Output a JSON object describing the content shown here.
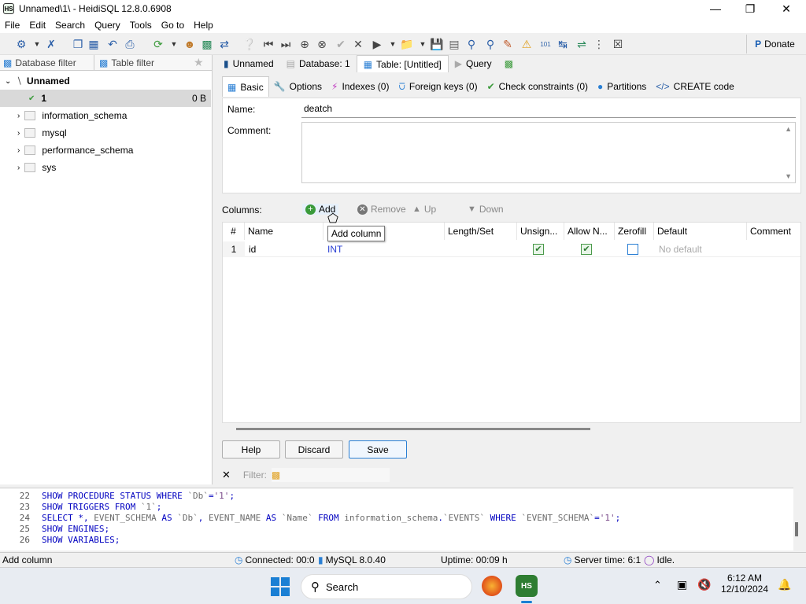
{
  "window": {
    "title": "Unnamed\\1\\ - HeidiSQL 12.8.0.6908",
    "app_icon": "HS"
  },
  "menu": [
    "File",
    "Edit",
    "Search",
    "Query",
    "Tools",
    "Go to",
    "Help"
  ],
  "toolbar": {
    "donate_label": "Donate"
  },
  "left_pane": {
    "db_filter_placeholder": "Database filter",
    "table_filter_placeholder": "Table filter",
    "root": "Unnamed",
    "selected_db": {
      "name": "1",
      "size": "0 B"
    },
    "databases": [
      "information_schema",
      "mysql",
      "performance_schema",
      "sys"
    ]
  },
  "tabs": [
    {
      "label": "Unnamed"
    },
    {
      "label": "Database: 1"
    },
    {
      "label": "Table: [Untitled]"
    },
    {
      "label": "Query"
    }
  ],
  "subtabs": [
    "Basic",
    "Options",
    "Indexes (0)",
    "Foreign keys (0)",
    "Check constraints (0)",
    "Partitions",
    "CREATE code"
  ],
  "basic": {
    "name_label": "Name:",
    "name_value": "deatch",
    "comment_label": "Comment:"
  },
  "columns_bar": {
    "label": "Columns:",
    "add": "Add",
    "remove": "Remove",
    "up": "Up",
    "down": "Down"
  },
  "tooltip": "Add column",
  "grid": {
    "headers": [
      "#",
      "Name",
      "D",
      "Length/Set",
      "Unsign...",
      "Allow N...",
      "Zerofill",
      "Default",
      "Comment"
    ],
    "rows": [
      {
        "num": "1",
        "name": "id",
        "datatype": "INT",
        "unsigned": true,
        "allow_null": true,
        "zerofill": false,
        "default": "No default"
      }
    ]
  },
  "buttons": {
    "help": "Help",
    "discard": "Discard",
    "save": "Save"
  },
  "filter": {
    "label": "Filter:"
  },
  "sql_log": [
    {
      "num": "22",
      "parts": [
        [
          "kw",
          "SHOW PROCEDURE STATUS WHERE "
        ],
        [
          "id",
          "`Db`"
        ],
        [
          "kw",
          "="
        ],
        [
          "str",
          "'1'"
        ],
        [
          "kw",
          ";"
        ]
      ]
    },
    {
      "num": "23",
      "parts": [
        [
          "kw",
          "SHOW TRIGGERS FROM "
        ],
        [
          "id",
          "`1`"
        ],
        [
          "kw",
          ";"
        ]
      ]
    },
    {
      "num": "24",
      "parts": [
        [
          "kw",
          "SELECT *, "
        ],
        [
          "id",
          "EVENT_SCHEMA"
        ],
        [
          "kw",
          " AS "
        ],
        [
          "id",
          "`Db`"
        ],
        [
          "kw",
          ", "
        ],
        [
          "id",
          "EVENT_NAME"
        ],
        [
          "kw",
          " AS "
        ],
        [
          "id",
          "`Name`"
        ],
        [
          "kw",
          " FROM "
        ],
        [
          "id",
          "information_schema"
        ],
        [
          "kw",
          "."
        ],
        [
          "id",
          "`EVENTS`"
        ],
        [
          "kw",
          " WHERE "
        ],
        [
          "id",
          "`EVENT_SCHEMA`"
        ],
        [
          "kw",
          "="
        ],
        [
          "str",
          "'1'"
        ],
        [
          "kw",
          ";"
        ]
      ]
    },
    {
      "num": "25",
      "parts": [
        [
          "kw",
          "SHOW ENGINES;"
        ]
      ]
    },
    {
      "num": "26",
      "parts": [
        [
          "kw",
          "SHOW VARIABLES;"
        ]
      ]
    }
  ],
  "status": {
    "hint": "Add column",
    "connected": "Connected: 00:0",
    "server": "MySQL 8.0.40",
    "uptime": "Uptime: 00:09 h",
    "server_time": "Server time: 6:1",
    "state": "Idle."
  },
  "taskbar": {
    "search": "Search",
    "time": "6:12 AM",
    "date": "12/10/2024"
  },
  "colors": {
    "accent": "#2a7fd4",
    "keyword": "#0000c0",
    "check_green": "#2e7d32"
  }
}
